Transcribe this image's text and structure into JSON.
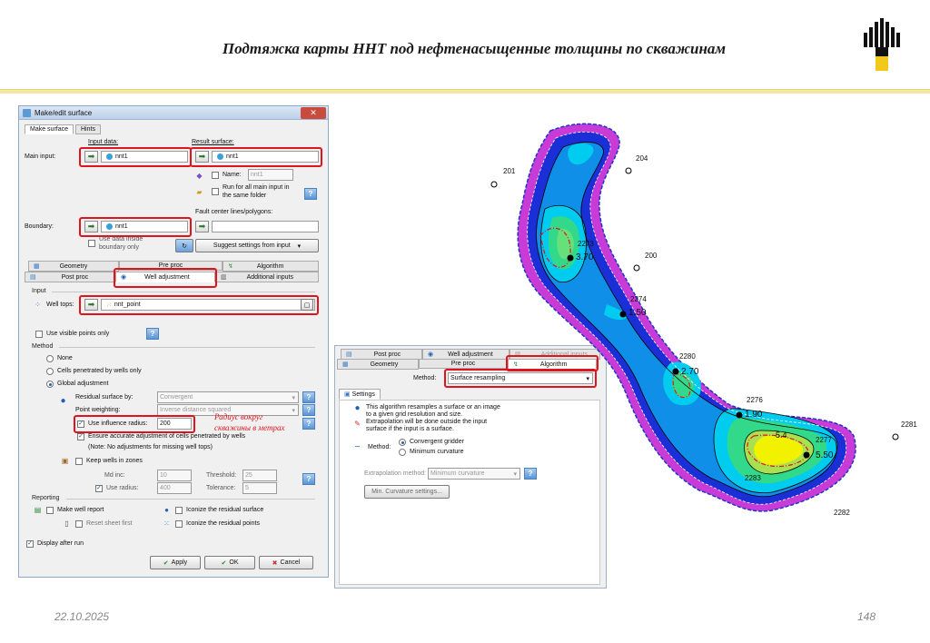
{
  "slide": {
    "title": "Подтяжка карты ННТ под нефтенасыщенные толщины по скважинам",
    "date": "22.10.2025",
    "page": "148"
  },
  "dialog": {
    "title": "Make/edit surface",
    "tabs": [
      "Make surface",
      "Hints"
    ],
    "input_data_label": "Input data:",
    "result_surface_label": "Result surface:",
    "main_input_label": "Main input:",
    "main_input_value": "nnt1",
    "result_value": "nnt1",
    "name_label": "Name:",
    "name_value": "nnt1",
    "run_all_label_1": "Run for all main input in",
    "run_all_label_2": "the same folder",
    "fault_label": "Fault center lines/polygons:",
    "boundary_label": "Boundary:",
    "boundary_value": "nnt1",
    "use_data_label_1": "Use data inside",
    "use_data_label_2": "boundary only",
    "suggest_btn": "Suggest settings from input",
    "subtabs_row1": [
      "Geometry",
      "Pre proc",
      "Algorithm"
    ],
    "subtabs_row2": [
      "Post proc",
      "Well adjustment",
      "Additional inputs"
    ],
    "input_section": "Input",
    "well_tops_label": "Well tops:",
    "well_tops_value": "nnt_point",
    "use_visible_label": "Use visible points only",
    "method_section": "Method",
    "method_none": "None",
    "method_cells": "Cells penetrated by wells only",
    "method_global": "Global adjustment",
    "residual_label": "Residual surface by:",
    "residual_value": "Convergent",
    "point_weight_label": "Point weighting:",
    "point_weight_value": "Inverse distance squared",
    "use_influence_label": "Use influence radius:",
    "use_influence_value": "200",
    "ensure_label": "Ensure accurate adjustment of cells penetrated by wells",
    "note_label": "(Note: No adjustments for missing well tops)",
    "keep_wells_label": "Keep wells in zones",
    "md_inc_label": "Md inc:",
    "md_inc_value": "10",
    "threshold_label": "Threshold:",
    "threshold_value": "25",
    "use_radius_label": "Use radius:",
    "use_radius_value": "400",
    "tolerance_label": "Tolerance:",
    "tolerance_value": "5",
    "reporting_section": "Reporting",
    "make_well_report": "Make well report",
    "iconize_residual": "Iconize the residual surface",
    "reset_sheet": "Reset sheet first",
    "iconize_points": "Iconize the residual points",
    "display_after": "Display after run",
    "apply_btn": "Apply",
    "ok_btn": "OK",
    "cancel_btn": "Cancel"
  },
  "annotation": {
    "line1": "Радиус вокруг",
    "line2": "скважины в метрах"
  },
  "dialog2": {
    "tabs_row1": [
      "Post proc",
      "Well adjustment",
      "Additional inputs"
    ],
    "tabs_row2": [
      "Geometry",
      "Pre proc",
      "Algorithm"
    ],
    "method_label": "Method:",
    "method_value": "Surface resampling",
    "settings_tab": "Settings",
    "desc_1": "This algorithm resamples a surface or an image",
    "desc_2": "to a given grid resolution and size.",
    "desc_3": "Extrapolation will be done outside the input",
    "desc_4": "surface if the input is a surface.",
    "method2_label": "Method:",
    "opt_convergent": "Convergent gridder",
    "opt_minimum": "Minimum curvature",
    "extrap_label": "Extrapolation method:",
    "extrap_value": "Minimum curvature",
    "min_curv_btn": "Min. Curvature settings..."
  },
  "map": {
    "wells": [
      {
        "name": "201"
      },
      {
        "name": "204"
      },
      {
        "name": "200"
      },
      {
        "name": "2281"
      },
      {
        "name": "2282"
      },
      {
        "name": "2283"
      },
      {
        "name": "2276"
      },
      {
        "name": "2280"
      },
      {
        "name": "2273"
      },
      {
        "name": "2274"
      },
      {
        "name": "2277"
      }
    ],
    "values": [
      "3.70",
      "1.50",
      "2.70",
      "1.90",
      "5.50"
    ],
    "contour_labels": [
      "5.4"
    ]
  }
}
